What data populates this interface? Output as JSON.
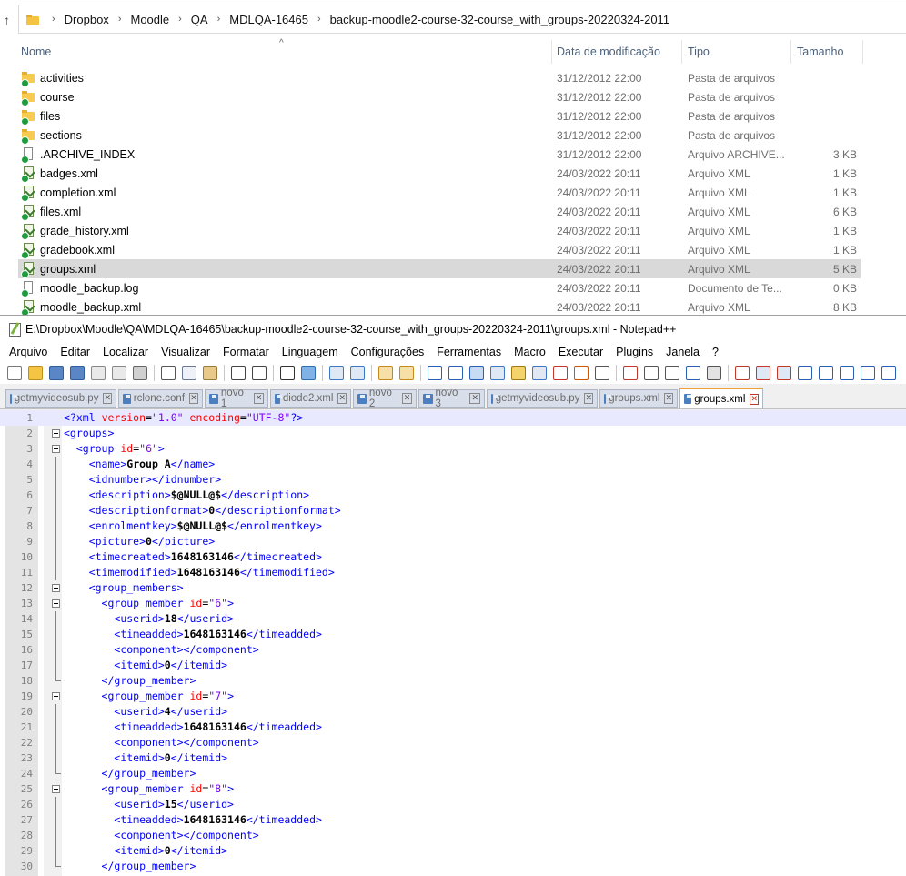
{
  "explorer": {
    "breadcrumb": [
      "Dropbox",
      "Moodle",
      "QA",
      "MDLQA-16465",
      "backup-moodle2-course-32-course_with_groups-20220324-2011"
    ],
    "columns": {
      "name": "Nome",
      "date": "Data de modificação",
      "type": "Tipo",
      "size": "Tamanho"
    },
    "files": [
      {
        "name": "activities",
        "date": "31/12/2012 22:00",
        "type": "Pasta de arquivos",
        "size": "",
        "icon": "folder-icon"
      },
      {
        "name": "course",
        "date": "31/12/2012 22:00",
        "type": "Pasta de arquivos",
        "size": "",
        "icon": "folder-icon"
      },
      {
        "name": "files",
        "date": "31/12/2012 22:00",
        "type": "Pasta de arquivos",
        "size": "",
        "icon": "folder-icon"
      },
      {
        "name": "sections",
        "date": "31/12/2012 22:00",
        "type": "Pasta de arquivos",
        "size": "",
        "icon": "folder-icon"
      },
      {
        "name": ".ARCHIVE_INDEX",
        "date": "31/12/2012 22:00",
        "type": "Arquivo ARCHIVE...",
        "size": "3 KB",
        "icon": "file-icon"
      },
      {
        "name": "badges.xml",
        "date": "24/03/2022 20:11",
        "type": "Arquivo XML",
        "size": "1 KB",
        "icon": "xml-file-icon"
      },
      {
        "name": "completion.xml",
        "date": "24/03/2022 20:11",
        "type": "Arquivo XML",
        "size": "1 KB",
        "icon": "xml-file-icon"
      },
      {
        "name": "files.xml",
        "date": "24/03/2022 20:11",
        "type": "Arquivo XML",
        "size": "6 KB",
        "icon": "xml-file-icon"
      },
      {
        "name": "grade_history.xml",
        "date": "24/03/2022 20:11",
        "type": "Arquivo XML",
        "size": "1 KB",
        "icon": "xml-file-icon"
      },
      {
        "name": "gradebook.xml",
        "date": "24/03/2022 20:11",
        "type": "Arquivo XML",
        "size": "1 KB",
        "icon": "xml-file-icon"
      },
      {
        "name": "groups.xml",
        "date": "24/03/2022 20:11",
        "type": "Arquivo XML",
        "size": "5 KB",
        "icon": "xml-file-icon",
        "selected": true
      },
      {
        "name": "moodle_backup.log",
        "date": "24/03/2022 20:11",
        "type": "Documento de Te...",
        "size": "0 KB",
        "icon": "file-icon"
      },
      {
        "name": "moodle_backup.xml",
        "date": "24/03/2022 20:11",
        "type": "Arquivo XML",
        "size": "8 KB",
        "icon": "xml-file-icon"
      }
    ]
  },
  "notepad": {
    "title": "E:\\Dropbox\\Moodle\\QA\\MDLQA-16465\\backup-moodle2-course-32-course_with_groups-20220324-2011\\groups.xml - Notepad++",
    "menu": [
      "Arquivo",
      "Editar",
      "Localizar",
      "Visualizar",
      "Formatar",
      "Linguagem",
      "Configurações",
      "Ferramentas",
      "Macro",
      "Executar",
      "Plugins",
      "Janela",
      "?"
    ],
    "tabs": [
      {
        "label": "getmyvideosub.py",
        "active": false
      },
      {
        "label": "rclone.conf",
        "active": false
      },
      {
        "label": "novo 1",
        "active": false
      },
      {
        "label": "diode2.xml",
        "active": false
      },
      {
        "label": "novo 2",
        "active": false
      },
      {
        "label": "novo 3",
        "active": false
      },
      {
        "label": "getmyvideosub.py",
        "active": false
      },
      {
        "label": "groups.xml",
        "active": false
      },
      {
        "label": "groups.xml",
        "active": true
      }
    ],
    "lines": [
      "<?xml version=\"1.0\" encoding=\"UTF-8\"?>",
      "<groups>",
      "  <group id=\"6\">",
      "    <name>Group A</name>",
      "    <idnumber></idnumber>",
      "    <description>$@NULL@$</description>",
      "    <descriptionformat>0</descriptionformat>",
      "    <enrolmentkey>$@NULL@$</enrolmentkey>",
      "    <picture>0</picture>",
      "    <timecreated>1648163146</timecreated>",
      "    <timemodified>1648163146</timemodified>",
      "    <group_members>",
      "      <group_member id=\"6\">",
      "        <userid>18</userid>",
      "        <timeadded>1648163146</timeadded>",
      "        <component></component>",
      "        <itemid>0</itemid>",
      "      </group_member>",
      "      <group_member id=\"7\">",
      "        <userid>4</userid>",
      "        <timeadded>1648163146</timeadded>",
      "        <component></component>",
      "        <itemid>0</itemid>",
      "      </group_member>",
      "      <group_member id=\"8\">",
      "        <userid>15</userid>",
      "        <timeadded>1648163146</timeadded>",
      "        <component></component>",
      "        <itemid>0</itemid>",
      "      </group_member>"
    ]
  }
}
